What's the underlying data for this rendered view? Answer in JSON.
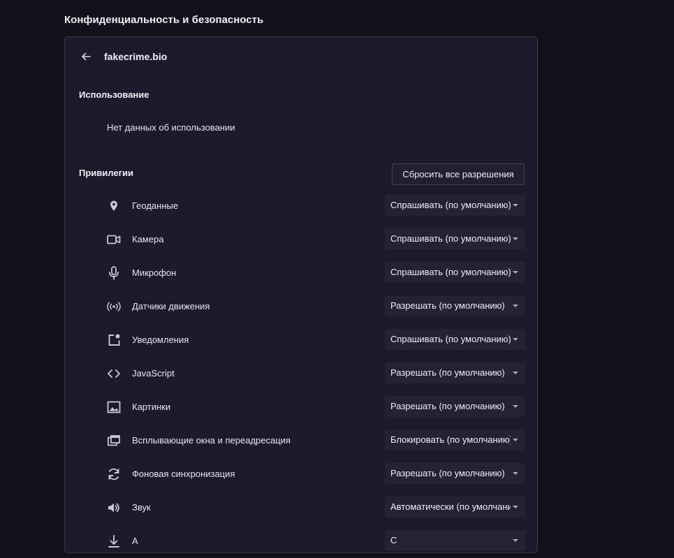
{
  "section_title": "Конфиденциальность и безопасность",
  "site": {
    "name": "fakecrime.bio",
    "back_icon": "arrow-left-icon"
  },
  "usage": {
    "title": "Использование",
    "text": "Нет данных об использовании"
  },
  "permissions": {
    "title": "Привилегии",
    "reset_label": "Сбросить все разрешения",
    "items": [
      {
        "icon": "location-pin-icon",
        "label": "Геоданные",
        "value": "Спрашивать (по умолчанию)"
      },
      {
        "icon": "camera-icon",
        "label": "Камера",
        "value": "Спрашивать (по умолчанию)"
      },
      {
        "icon": "microphone-icon",
        "label": "Микрофон",
        "value": "Спрашивать (по умолчанию)"
      },
      {
        "icon": "motion-sensors-icon",
        "label": "Датчики движения",
        "value": "Разрешать (по умолчанию)"
      },
      {
        "icon": "notifications-icon",
        "label": "Уведомления",
        "value": "Спрашивать (по умолчанию)"
      },
      {
        "icon": "code-icon",
        "label": "JavaScript",
        "value": "Разрешать (по умолчанию)"
      },
      {
        "icon": "image-icon",
        "label": "Картинки",
        "value": "Разрешать (по умолчанию)"
      },
      {
        "icon": "popup-icon",
        "label": "Всплывающие окна и переадресация",
        "value": "Блокировать (по умолчанию)"
      },
      {
        "icon": "sync-icon",
        "label": "Фоновая синхронизация",
        "value": "Разрешать (по умолчанию)"
      },
      {
        "icon": "sound-icon",
        "label": "Звук",
        "value": "Автоматически (по умолчанию)"
      },
      {
        "icon": "download-icon",
        "label": "А",
        "value": "С"
      }
    ]
  },
  "colors": {
    "page_bg": "#121019",
    "card_bg": "#1e1a2b",
    "select_bg": "#262133",
    "icon_color": "#c9c5d4"
  }
}
